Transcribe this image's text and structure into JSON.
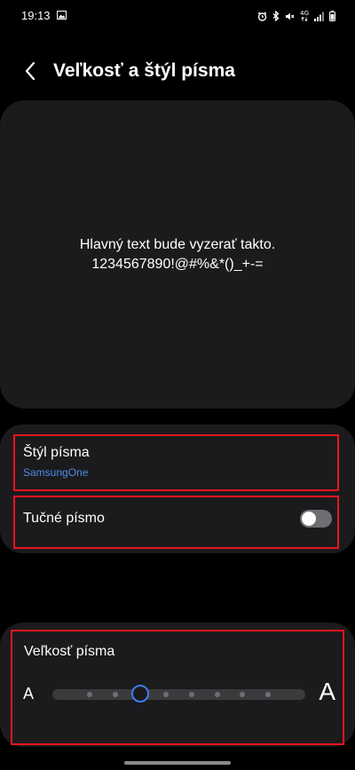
{
  "status_bar": {
    "time": "19:13",
    "network_label": "4G",
    "icons": [
      "gallery-icon",
      "alarm-icon",
      "bluetooth-icon",
      "mute-icon",
      "mobile-data-icon",
      "signal-icon",
      "battery-icon"
    ]
  },
  "header": {
    "title": "Veľkosť a štýl písma",
    "back_icon": "chevron-left-icon"
  },
  "preview": {
    "line1": "Hlavný text bude vyzerať takto.",
    "line2": "1234567890!@#%&*()_+-="
  },
  "font_style": {
    "title": "Štýl písma",
    "value": "SamsungOne"
  },
  "bold": {
    "title": "Tučné písmo",
    "enabled": false
  },
  "size": {
    "title": "Veľkosť písma",
    "small_label": "A",
    "large_label": "A",
    "steps": 8,
    "selected_step": 2
  },
  "colors": {
    "accent": "#3f7cf0",
    "link": "#4d8ae6",
    "highlight_border": "#e8141c",
    "card": "#1b1b1d",
    "background": "#000000"
  }
}
